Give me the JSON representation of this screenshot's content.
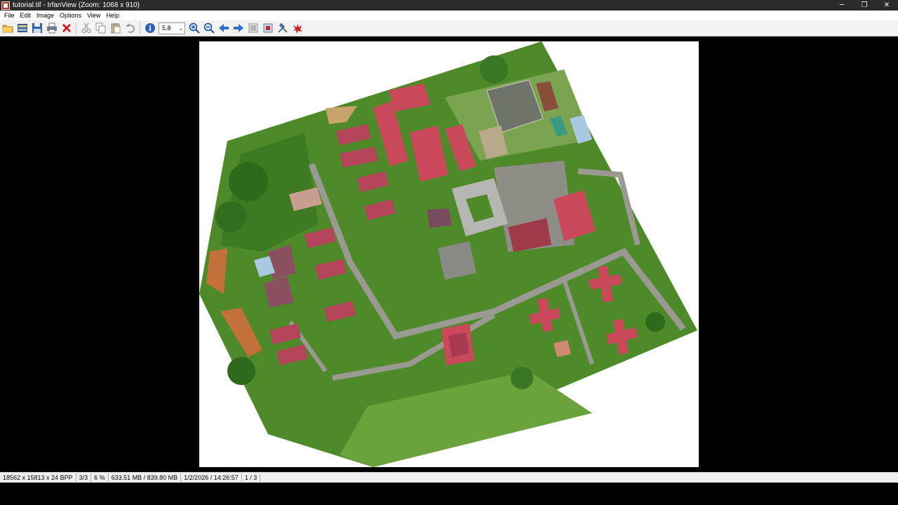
{
  "window": {
    "title": "tutorial.tif - IrfanView (Zoom: 1068 x 910)",
    "controls": {
      "minimize": "─",
      "restore": "❐",
      "close": "✕"
    }
  },
  "menu": [
    "File",
    "Edit",
    "Image",
    "Options",
    "View",
    "Help"
  ],
  "toolbar": {
    "zoom_value": "5.8",
    "icons": [
      "open-folder-icon",
      "thumbnails-icon",
      "save-icon",
      "print-icon",
      "delete-icon",
      "cut-icon",
      "copy-icon",
      "paste-icon",
      "undo-icon",
      "info-icon",
      "zoom-in-icon",
      "zoom-out-icon",
      "previous-icon",
      "next-icon",
      "slideshow-icon",
      "fullscreen-icon",
      "settings-icon",
      "irfanview-logo-icon"
    ]
  },
  "status": {
    "dimensions": "18562 x 15813 x 24 BPP",
    "file_index": "3/3",
    "zoom_percent": "6 %",
    "memory": "633.51 MB / 839.80 MB",
    "datetime": "1/2/2026 / 14:26:57",
    "page": "1 / 3"
  },
  "colors": {
    "titlebar": "#2b2b2b",
    "canvas": "#000000",
    "vegetation": "#4f8a2a",
    "roof": "#c9485a",
    "road": "#9a9a92"
  }
}
